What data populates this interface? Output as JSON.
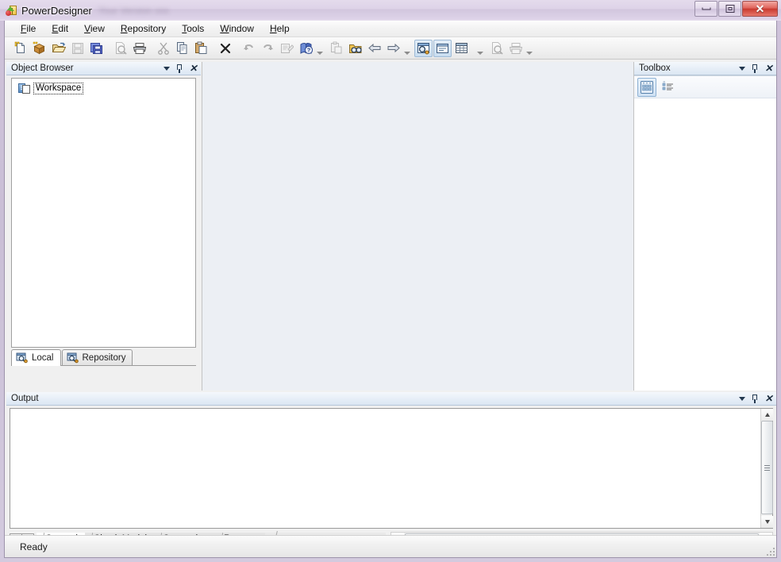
{
  "window": {
    "title": "PowerDesigner",
    "subtitle_redacted": "",
    "icon": "powerdesigner-icon",
    "controls": {
      "minimize": "minimize-button",
      "restore": "restore-button",
      "close": "close-button",
      "close_glyph": "✕"
    }
  },
  "menubar": {
    "items": [
      {
        "label": "File",
        "accesskey": "F"
      },
      {
        "label": "Edit",
        "accesskey": "E"
      },
      {
        "label": "View",
        "accesskey": "V"
      },
      {
        "label": "Repository",
        "accesskey": "R"
      },
      {
        "label": "Tools",
        "accesskey": "T"
      },
      {
        "label": "Window",
        "accesskey": "W"
      },
      {
        "label": "Help",
        "accesskey": "H"
      }
    ]
  },
  "toolbar": {
    "groups": [
      {
        "buttons": [
          {
            "name": "new-model-icon",
            "enabled": true
          },
          {
            "name": "new-package-icon",
            "enabled": true
          },
          {
            "name": "open-model-icon",
            "enabled": true
          },
          {
            "name": "save-icon",
            "enabled": false
          },
          {
            "name": "save-all-icon",
            "enabled": true
          },
          {
            "name": "print-preview-icon",
            "enabled": false
          },
          {
            "name": "print-icon",
            "enabled": true
          },
          {
            "name": "cut-icon",
            "enabled": false
          },
          {
            "name": "copy-icon",
            "enabled": true
          },
          {
            "name": "paste-icon",
            "enabled": true
          },
          {
            "name": "delete-icon",
            "enabled": true
          },
          {
            "name": "undo-icon",
            "enabled": false
          },
          {
            "name": "redo-icon",
            "enabled": false
          },
          {
            "name": "properties-icon",
            "enabled": false
          },
          {
            "name": "help-icon",
            "enabled": true
          }
        ]
      },
      {
        "buttons": [
          {
            "name": "paste-special-icon",
            "enabled": false
          },
          {
            "name": "find-objects-icon",
            "enabled": true
          },
          {
            "name": "previous-icon",
            "enabled": true
          },
          {
            "name": "next-icon",
            "enabled": true
          }
        ]
      },
      {
        "buttons": [
          {
            "name": "toggle-object-browser-icon",
            "enabled": true,
            "pressed": true
          },
          {
            "name": "toggle-output-window-icon",
            "enabled": true,
            "pressed": true
          },
          {
            "name": "toggle-result-list-icon",
            "enabled": true,
            "pressed": false
          }
        ]
      },
      {
        "buttons": [
          {
            "name": "page-setup-icon",
            "enabled": false
          },
          {
            "name": "print-model-icon",
            "enabled": false
          }
        ]
      }
    ]
  },
  "object_browser": {
    "title": "Object Browser",
    "panel_buttons": {
      "menu": "chevron-down-icon",
      "pin": "pin-icon",
      "close": "close-icon"
    },
    "tree": [
      {
        "label": "Workspace",
        "icon": "workspace-icon",
        "selected": true
      }
    ],
    "tabs": [
      {
        "label": "Local",
        "icon": "local-icon",
        "active": true
      },
      {
        "label": "Repository",
        "icon": "repository-icon",
        "active": false
      }
    ]
  },
  "toolbox": {
    "title": "Toolbox",
    "panel_buttons": {
      "menu": "chevron-down-icon",
      "pin": "pin-icon",
      "close": "close-icon"
    },
    "view_buttons": [
      {
        "name": "grid-view-icon",
        "active": true
      },
      {
        "name": "list-view-icon",
        "active": false
      }
    ]
  },
  "output": {
    "title": "Output",
    "panel_buttons": {
      "menu": "chevron-down-icon",
      "pin": "pin-icon",
      "close": "close-icon"
    },
    "content": "",
    "tabs": [
      {
        "label": "General",
        "active": true
      },
      {
        "label": "Check Model",
        "active": false
      },
      {
        "label": "Generation",
        "active": false
      },
      {
        "label": "Reverse",
        "active": false
      }
    ],
    "tab_nav": {
      "prev": "scroll-tabs-left-icon",
      "next": "scroll-tabs-right-icon"
    },
    "hscroll_grip": "|||"
  },
  "statusbar": {
    "message": "Ready"
  },
  "colors": {
    "title_bar": "#ded3e8",
    "mdi_background": "#eceff4",
    "panel_header": "#e6eef7",
    "close_button": "#c93a30",
    "selection": "#cfe1f3"
  }
}
